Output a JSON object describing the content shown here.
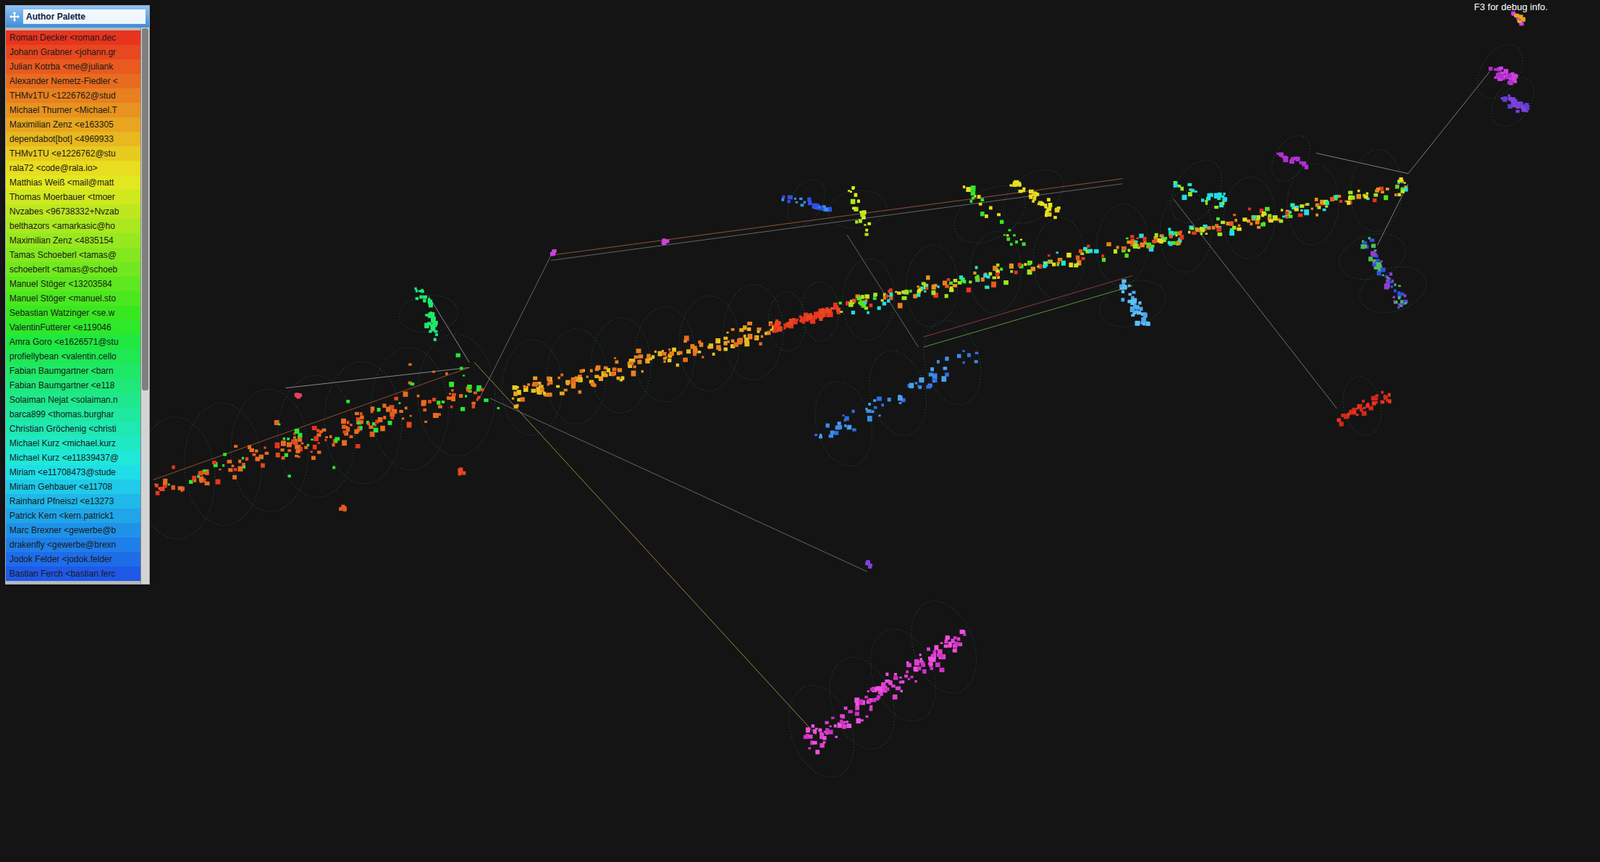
{
  "palette": {
    "title": "Author Palette",
    "authors": [
      {
        "name": "Roman Decker <roman.dec",
        "color": "#e8341f"
      },
      {
        "name": "Johann Grabner <johann.gr",
        "color": "#e8471f"
      },
      {
        "name": "Julian Kotrba <me@juliank",
        "color": "#e85a1f"
      },
      {
        "name": "Alexander Nemetz-Fiedler <",
        "color": "#e86c1f"
      },
      {
        "name": "THMv1TU <1226762@stud",
        "color": "#e8801f"
      },
      {
        "name": "Michael Thurner <Michael.T",
        "color": "#e8921f"
      },
      {
        "name": "Maximilian Zenz <e163305",
        "color": "#e8a51f"
      },
      {
        "name": "dependabot[bot] <4969933",
        "color": "#e8b81f"
      },
      {
        "name": "THMv1TU <e1226762@stu",
        "color": "#e8cb1f"
      },
      {
        "name": "rala72 <code@rala.io>",
        "color": "#e8dd1f"
      },
      {
        "name": "Matthias Weiß <mail@matt",
        "color": "#e2e81f"
      },
      {
        "name": "Thomas Moerbauer <tmoer",
        "color": "#d1e81f"
      },
      {
        "name": "Nvzabes <96738332+Nvzab",
        "color": "#bde81f"
      },
      {
        "name": "belthazors <amarkasic@ho",
        "color": "#aae81f"
      },
      {
        "name": "Maximilian Zenz <4835154",
        "color": "#97e81f"
      },
      {
        "name": "Tamas Schoeberl <tamas@",
        "color": "#84e81f"
      },
      {
        "name": "schoeberlt <tamas@schoeb",
        "color": "#71e81f"
      },
      {
        "name": "Manuel Stöger <13203584",
        "color": "#5ee81f"
      },
      {
        "name": "Manuel Stöger <manuel.sto",
        "color": "#4be81f"
      },
      {
        "name": "Sebastian Watzinger <se.w",
        "color": "#38e81f"
      },
      {
        "name": "ValentinFutterer <e119046",
        "color": "#2ee82a"
      },
      {
        "name": "Amra Goro <e1626571@stu",
        "color": "#1fe840"
      },
      {
        "name": "profiellybean <valentin.cello",
        "color": "#1fe853"
      },
      {
        "name": "Fabian Baumgartner <barn",
        "color": "#1fe866"
      },
      {
        "name": "Fabian Baumgartner <e118",
        "color": "#1fe879"
      },
      {
        "name": "Solaiman Nejat <solaiman.n",
        "color": "#1fe88c"
      },
      {
        "name": "barca899 <thomas.burghar",
        "color": "#1fe89f"
      },
      {
        "name": "Christian Gröchenig <christi",
        "color": "#1fe8b2"
      },
      {
        "name": "Michael Kurz <michael.kurz",
        "color": "#1fe8c5"
      },
      {
        "name": "Michael Kurz <e11839437@",
        "color": "#1fe8d8"
      },
      {
        "name": "Miriam <e11708473@stude",
        "color": "#1fdee8"
      },
      {
        "name": "Miriam Gehbauer <e11708",
        "color": "#1fcbe8"
      },
      {
        "name": "Rainhard Pfneiszl <e13273",
        "color": "#1fb8e8"
      },
      {
        "name": "Patrick Kern <kern.patrick1",
        "color": "#1fa5e8"
      },
      {
        "name": "Marc Brexner <gewerbe@b",
        "color": "#1f92e8"
      },
      {
        "name": "drakenfly <gewerbe@brexn",
        "color": "#1f7fe8"
      },
      {
        "name": "Jodok Felder <jodok.felder",
        "color": "#1f6ce8"
      },
      {
        "name": "Bastian Ferch <bastian.ferc",
        "color": "#1f59e8"
      }
    ]
  },
  "debug_hint": "F3 for debug info."
}
